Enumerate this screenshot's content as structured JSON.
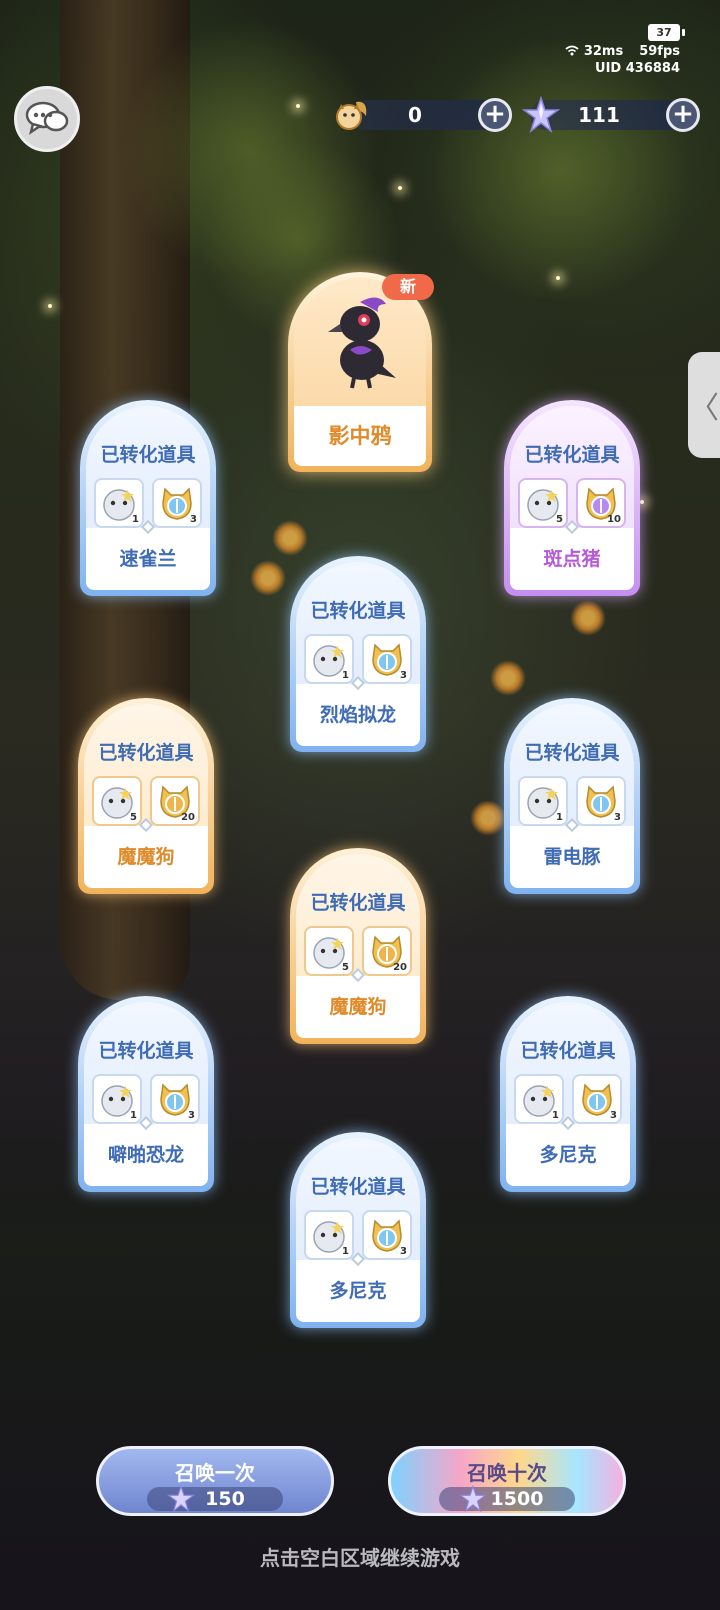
{
  "status": {
    "battery": "37",
    "ping": "32ms",
    "fps": "59fps",
    "uid": "UID 436884"
  },
  "currencies": [
    {
      "icon": "squirrel-currency-icon",
      "amount": "0",
      "plus": "+"
    },
    {
      "icon": "star-crystal-icon",
      "amount": "111",
      "plus": "+"
    }
  ],
  "side_tab": "〈",
  "featured": {
    "name": "影中鸦",
    "badge": "新",
    "icon": "shadow-crow-creature-icon"
  },
  "cards": [
    {
      "title": "已转化道具",
      "name": "速雀兰",
      "style": "blue",
      "items": [
        {
          "icon": "creature-icon",
          "count": "1"
        },
        {
          "icon": "cat-medal-blue-icon",
          "count": "3"
        }
      ]
    },
    {
      "title": "已转化道具",
      "name": "斑点猪",
      "style": "purple",
      "items": [
        {
          "icon": "creature-icon",
          "count": "5"
        },
        {
          "icon": "cat-medal-purple-icon",
          "count": "10"
        }
      ]
    },
    {
      "title": "已转化道具",
      "name": "烈焰拟龙",
      "style": "blue",
      "items": [
        {
          "icon": "creature-icon",
          "count": "1"
        },
        {
          "icon": "cat-medal-blue-icon",
          "count": "3"
        }
      ]
    },
    {
      "title": "已转化道具",
      "name": "魔魔狗",
      "style": "orange",
      "items": [
        {
          "icon": "creature-icon",
          "count": "5"
        },
        {
          "icon": "cat-medal-gold-icon",
          "count": "20"
        }
      ]
    },
    {
      "title": "已转化道具",
      "name": "雷电豚",
      "style": "blue",
      "items": [
        {
          "icon": "creature-icon",
          "count": "1"
        },
        {
          "icon": "cat-medal-blue-icon",
          "count": "3"
        }
      ]
    },
    {
      "title": "已转化道具",
      "name": "魔魔狗",
      "style": "orange",
      "items": [
        {
          "icon": "creature-icon",
          "count": "5"
        },
        {
          "icon": "cat-medal-gold-icon",
          "count": "20"
        }
      ]
    },
    {
      "title": "已转化道具",
      "name": "噼啪恐龙",
      "style": "blue",
      "items": [
        {
          "icon": "creature-icon",
          "count": "1"
        },
        {
          "icon": "cat-medal-blue-icon",
          "count": "3"
        }
      ]
    },
    {
      "title": "已转化道具",
      "name": "多尼克",
      "style": "blue",
      "items": [
        {
          "icon": "creature-icon",
          "count": "1"
        },
        {
          "icon": "cat-medal-blue-icon",
          "count": "3"
        }
      ]
    },
    {
      "title": "已转化道具",
      "name": "多尼克",
      "style": "blue",
      "items": [
        {
          "icon": "creature-icon",
          "count": "1"
        },
        {
          "icon": "cat-medal-blue-icon",
          "count": "3"
        }
      ]
    }
  ],
  "buttons": {
    "summon_one": {
      "label": "召唤一次",
      "cost": "150"
    },
    "summon_ten": {
      "label": "召唤十次",
      "cost": "1500"
    }
  },
  "hint": "点击空白区域继续游戏",
  "colors": {
    "blue_card": "#7fb2f0",
    "orange_card": "#f2b25a",
    "purple_card": "#c48ef0",
    "new_badge": "#f06a4a"
  }
}
